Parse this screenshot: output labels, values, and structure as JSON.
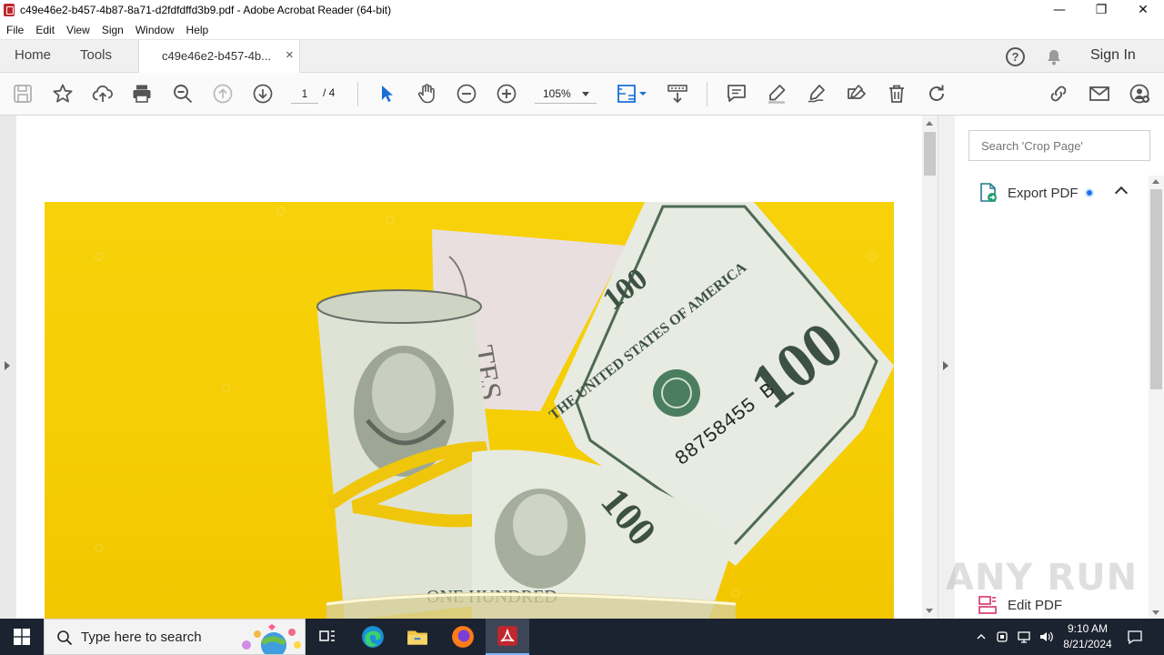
{
  "window": {
    "title": "c49e46e2-b457-4b87-8a71-d2fdfdffd3b9.pdf - Adobe Acrobat Reader (64-bit)",
    "controls": {
      "minimize": "—",
      "maximize": "❐",
      "close": "✕"
    }
  },
  "menubar": {
    "items": [
      "File",
      "Edit",
      "View",
      "Sign",
      "Window",
      "Help"
    ]
  },
  "tabs": {
    "home": "Home",
    "tools": "Tools",
    "document": "c49e46e2-b457-4b...",
    "close": "×",
    "help": "?",
    "sign_in": "Sign In"
  },
  "toolbar": {
    "current_page": "1",
    "total_pages": "/ 4",
    "zoom": "105%",
    "icons": [
      "save-icon",
      "star-icon",
      "upload-icon",
      "print-icon",
      "zoom-out-icon",
      "page-up-icon",
      "page-down-icon",
      "select-cursor-icon",
      "hand-icon",
      "zoom-minus-icon",
      "zoom-plus-icon",
      "fit-page-icon",
      "scroll-mode-icon",
      "comment-icon",
      "highlight-icon",
      "draw-icon",
      "fill-sign-icon",
      "delete-icon",
      "rotate-icon",
      "link-icon",
      "email-icon",
      "add-user-icon"
    ]
  },
  "right_panel": {
    "search_placeholder": "Search 'Crop Page'",
    "export_label": "Export PDF",
    "edit_label": "Edit PDF"
  },
  "document": {
    "image_subject": "dollar bills",
    "bill_texts": [
      "ONE HUNDRED",
      "100",
      "88758455 B",
      "THE UNITED STATES OF AMERICA"
    ]
  },
  "watermark": "ANY RUN",
  "taskbar": {
    "search_placeholder": "Type here to search",
    "time": "9:10 AM",
    "date": "8/21/2024"
  },
  "colors": {
    "accent_blue": "#1a73e8",
    "acrobat_red": "#c1272d",
    "photo_yellow": "#f5cd04",
    "taskbar": "#1b2330"
  }
}
